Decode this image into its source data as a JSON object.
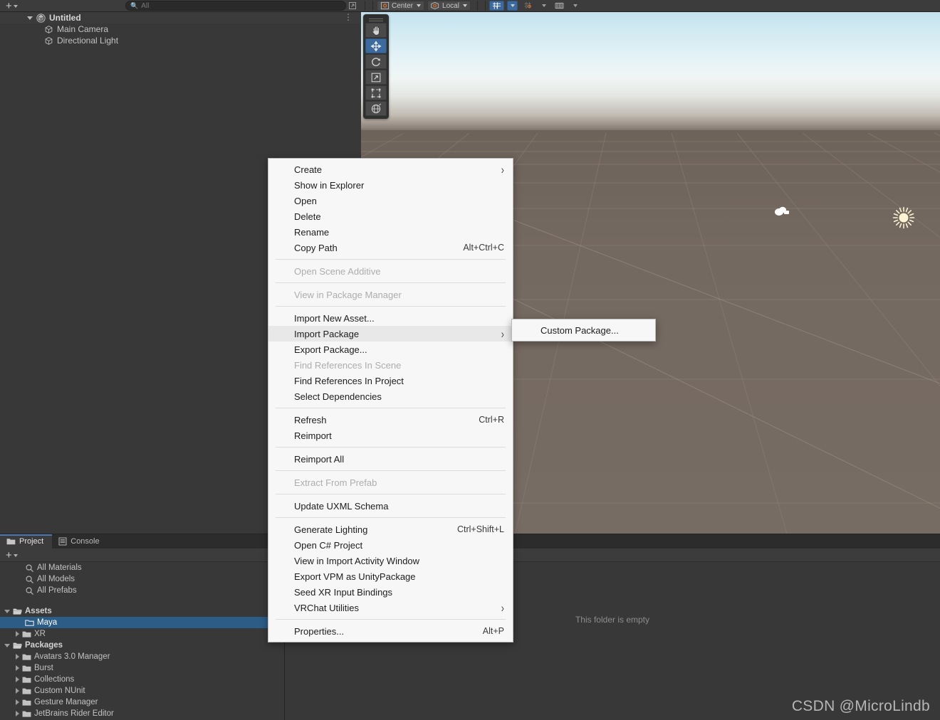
{
  "hierarchy": {
    "add_label": "+",
    "search_placeholder": "All",
    "search_value": "",
    "root": {
      "label": "Untitled",
      "icon": "unity-scene-icon"
    },
    "items": [
      {
        "label": "Main Camera",
        "icon": "gameobject-icon"
      },
      {
        "label": "Directional Light",
        "icon": "gameobject-icon"
      }
    ],
    "kebab": "⋮"
  },
  "scene_toolbar": {
    "pivot_label": "Center",
    "pivot_icon": "pivot-center-icon",
    "space_label": "Local",
    "space_icon": "handle-local-icon",
    "grid_icon": "grid-axis-y-icon",
    "snap_icon": "grid-snapping-icon",
    "layout_icon": "grid-size-icon",
    "dropdown_glyph": "▾"
  },
  "scene_tools": [
    {
      "name": "hand-tool",
      "label": "View Tool",
      "selected": false
    },
    {
      "name": "move-tool",
      "label": "Move Tool",
      "selected": true
    },
    {
      "name": "rotate-tool",
      "label": "Rotate Tool",
      "selected": false
    },
    {
      "name": "scale-tool",
      "label": "Scale Tool",
      "selected": false
    },
    {
      "name": "rect-tool",
      "label": "Rect Tool",
      "selected": false
    },
    {
      "name": "transform-tool",
      "label": "Transform Tool",
      "selected": false
    }
  ],
  "scene_gizmos": [
    {
      "name": "camera-gizmo",
      "label": "Main Camera"
    },
    {
      "name": "light-gizmo",
      "label": "Directional Light"
    }
  ],
  "context_menu": {
    "groups": [
      {
        "items": [
          {
            "label": "Create",
            "shortcut": "",
            "submenu": true,
            "disabled": false,
            "highlight": false
          },
          {
            "label": "Show in Explorer",
            "shortcut": "",
            "submenu": false,
            "disabled": false,
            "highlight": false
          },
          {
            "label": "Open",
            "shortcut": "",
            "submenu": false,
            "disabled": false,
            "highlight": false
          },
          {
            "label": "Delete",
            "shortcut": "",
            "submenu": false,
            "disabled": false,
            "highlight": false
          },
          {
            "label": "Rename",
            "shortcut": "",
            "submenu": false,
            "disabled": false,
            "highlight": false
          },
          {
            "label": "Copy Path",
            "shortcut": "Alt+Ctrl+C",
            "submenu": false,
            "disabled": false,
            "highlight": false
          }
        ]
      },
      {
        "items": [
          {
            "label": "Open Scene Additive",
            "shortcut": "",
            "submenu": false,
            "disabled": true,
            "highlight": false
          }
        ]
      },
      {
        "items": [
          {
            "label": "View in Package Manager",
            "shortcut": "",
            "submenu": false,
            "disabled": true,
            "highlight": false
          }
        ]
      },
      {
        "items": [
          {
            "label": "Import New Asset...",
            "shortcut": "",
            "submenu": false,
            "disabled": false,
            "highlight": false
          },
          {
            "label": "Import Package",
            "shortcut": "",
            "submenu": true,
            "disabled": false,
            "highlight": true
          },
          {
            "label": "Export Package...",
            "shortcut": "",
            "submenu": false,
            "disabled": false,
            "highlight": false
          },
          {
            "label": "Find References In Scene",
            "shortcut": "",
            "submenu": false,
            "disabled": true,
            "highlight": false
          },
          {
            "label": "Find References In Project",
            "shortcut": "",
            "submenu": false,
            "disabled": false,
            "highlight": false
          },
          {
            "label": "Select Dependencies",
            "shortcut": "",
            "submenu": false,
            "disabled": false,
            "highlight": false
          }
        ]
      },
      {
        "items": [
          {
            "label": "Refresh",
            "shortcut": "Ctrl+R",
            "submenu": false,
            "disabled": false,
            "highlight": false
          },
          {
            "label": "Reimport",
            "shortcut": "",
            "submenu": false,
            "disabled": false,
            "highlight": false
          }
        ]
      },
      {
        "items": [
          {
            "label": "Reimport All",
            "shortcut": "",
            "submenu": false,
            "disabled": false,
            "highlight": false
          }
        ]
      },
      {
        "items": [
          {
            "label": "Extract From Prefab",
            "shortcut": "",
            "submenu": false,
            "disabled": true,
            "highlight": false
          }
        ]
      },
      {
        "items": [
          {
            "label": "Update UXML Schema",
            "shortcut": "",
            "submenu": false,
            "disabled": false,
            "highlight": false
          }
        ]
      },
      {
        "items": [
          {
            "label": "Generate Lighting",
            "shortcut": "Ctrl+Shift+L",
            "submenu": false,
            "disabled": false,
            "highlight": false
          },
          {
            "label": "Open C# Project",
            "shortcut": "",
            "submenu": false,
            "disabled": false,
            "highlight": false
          },
          {
            "label": "View in Import Activity Window",
            "shortcut": "",
            "submenu": false,
            "disabled": false,
            "highlight": false
          },
          {
            "label": "Export VPM as UnityPackage",
            "shortcut": "",
            "submenu": false,
            "disabled": false,
            "highlight": false
          },
          {
            "label": "Seed XR Input Bindings",
            "shortcut": "",
            "submenu": false,
            "disabled": false,
            "highlight": false
          },
          {
            "label": "VRChat Utilities",
            "shortcut": "",
            "submenu": true,
            "disabled": false,
            "highlight": false
          }
        ]
      },
      {
        "items": [
          {
            "label": "Properties...",
            "shortcut": "Alt+P",
            "submenu": false,
            "disabled": false,
            "highlight": false
          }
        ]
      }
    ],
    "submenu": {
      "items": [
        {
          "label": "Custom Package...",
          "shortcut": "",
          "submenu": false,
          "disabled": false,
          "highlight": false
        }
      ]
    }
  },
  "project": {
    "tabs": [
      {
        "label": "Project",
        "icon": "folder-icon",
        "active": true
      },
      {
        "label": "Console",
        "icon": "console-icon",
        "active": false
      }
    ],
    "add_label": "+",
    "tree": [
      {
        "label": "All Materials",
        "icon": "search-icon",
        "indent": 22,
        "arrow": "none",
        "bold": false,
        "selected": false
      },
      {
        "label": "All Models",
        "icon": "search-icon",
        "indent": 22,
        "arrow": "none",
        "bold": false,
        "selected": false
      },
      {
        "label": "All Prefabs",
        "icon": "search-icon",
        "indent": 22,
        "arrow": "none",
        "bold": false,
        "selected": false
      },
      {
        "label": "",
        "icon": "spacer",
        "indent": 0,
        "arrow": "none",
        "bold": false,
        "selected": false
      },
      {
        "label": "Assets",
        "icon": "folder-open-icon",
        "indent": 6,
        "arrow": "open",
        "bold": true,
        "selected": false
      },
      {
        "label": "Maya",
        "icon": "folder-empty-icon",
        "indent": 22,
        "arrow": "none",
        "bold": false,
        "selected": true
      },
      {
        "label": "XR",
        "icon": "folder-icon",
        "indent": 22,
        "arrow": "closed",
        "bold": false,
        "selected": false
      },
      {
        "label": "Packages",
        "icon": "folder-open-icon",
        "indent": 6,
        "arrow": "open",
        "bold": true,
        "selected": false
      },
      {
        "label": "Avatars 3.0 Manager",
        "icon": "folder-icon",
        "indent": 22,
        "arrow": "closed",
        "bold": false,
        "selected": false
      },
      {
        "label": "Burst",
        "icon": "folder-icon",
        "indent": 22,
        "arrow": "closed",
        "bold": false,
        "selected": false
      },
      {
        "label": "Collections",
        "icon": "folder-icon",
        "indent": 22,
        "arrow": "closed",
        "bold": false,
        "selected": false
      },
      {
        "label": "Custom NUnit",
        "icon": "folder-icon",
        "indent": 22,
        "arrow": "closed",
        "bold": false,
        "selected": false
      },
      {
        "label": "Gesture Manager",
        "icon": "folder-icon",
        "indent": 22,
        "arrow": "closed",
        "bold": false,
        "selected": false
      },
      {
        "label": "JetBrains Rider Editor",
        "icon": "folder-icon",
        "indent": 22,
        "arrow": "closed",
        "bold": false,
        "selected": false
      }
    ],
    "empty_message": "This folder is empty"
  },
  "watermark": "CSDN @MicroLindb",
  "colors": {
    "panel_bg": "#383838",
    "toolbar_bg": "#3c3c3c",
    "selection_blue": "#2b5d87",
    "accent_blue": "#3d6a9e",
    "menu_bg": "#f7f7f7",
    "menu_highlight": "#e8e8e8",
    "ground": "#746961"
  }
}
